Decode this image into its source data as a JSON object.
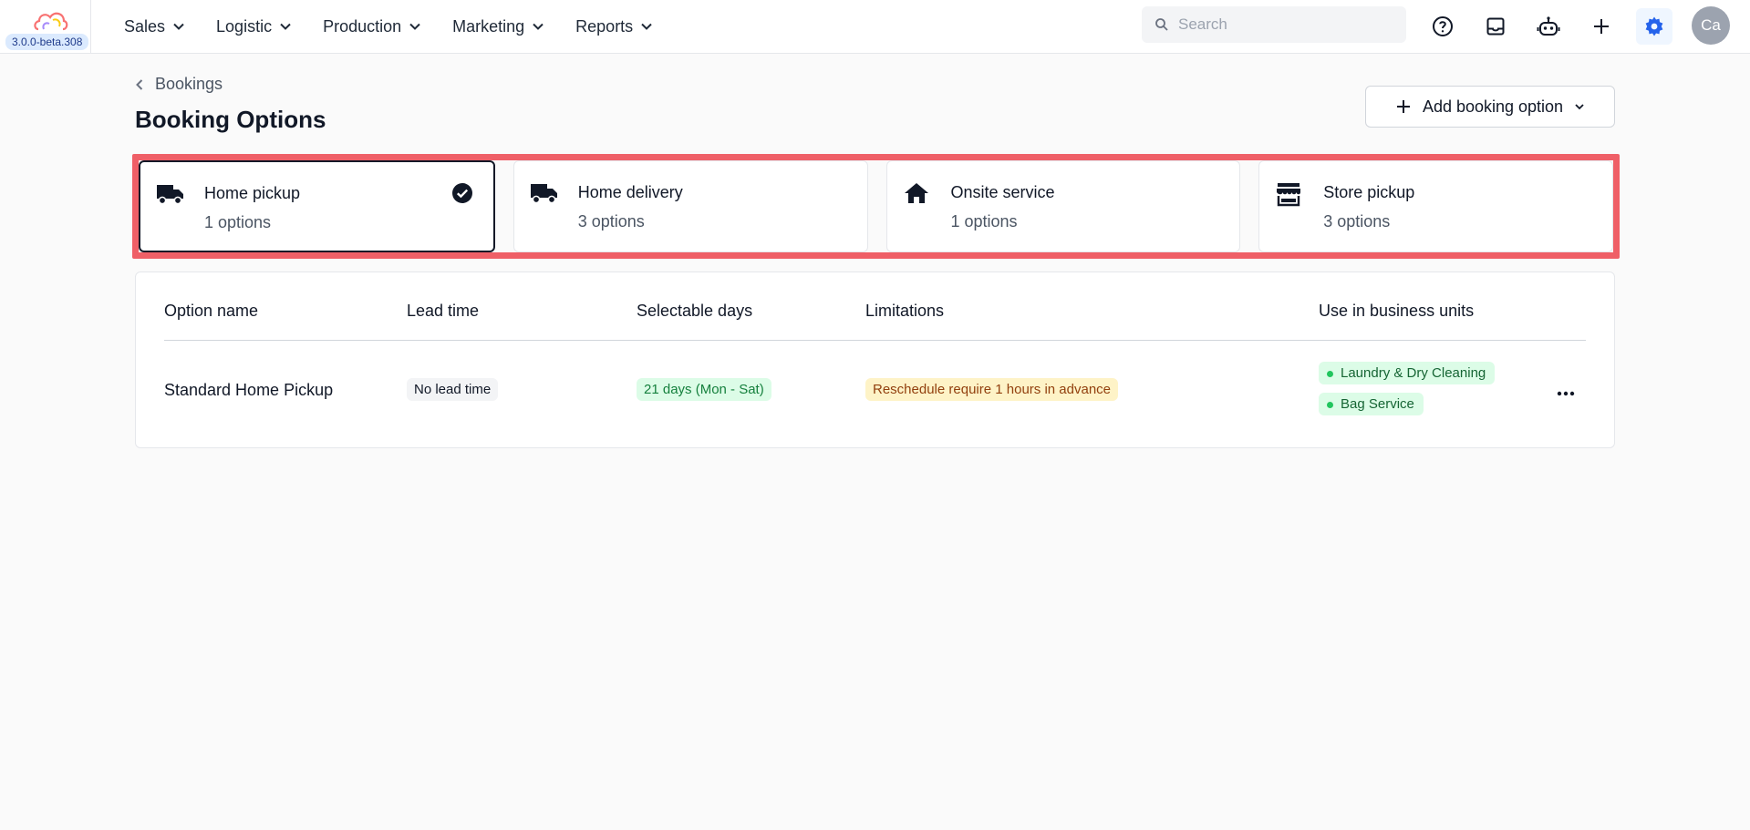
{
  "app": {
    "version": "3.0.0-beta.308"
  },
  "nav": {
    "items": [
      {
        "label": "Sales"
      },
      {
        "label": "Logistic"
      },
      {
        "label": "Production"
      },
      {
        "label": "Marketing"
      },
      {
        "label": "Reports"
      }
    ]
  },
  "search": {
    "placeholder": "Search",
    "value": ""
  },
  "toolbar_icons": [
    "help-icon",
    "inbox-icon",
    "bot-icon",
    "plus-icon",
    "settings-icon"
  ],
  "user": {
    "initials": "Ca"
  },
  "header": {
    "breadcrumb": "Bookings",
    "title": "Booking Options",
    "add_button_label": "Add booking option"
  },
  "booking_types": [
    {
      "name": "Home pickup",
      "count": "1 options",
      "icon": "truck-icon",
      "selected": true
    },
    {
      "name": "Home delivery",
      "count": "3 options",
      "icon": "truck-icon",
      "selected": false
    },
    {
      "name": "Onsite service",
      "count": "1 options",
      "icon": "house-icon",
      "selected": false
    },
    {
      "name": "Store pickup",
      "count": "3 options",
      "icon": "store-icon",
      "selected": false
    }
  ],
  "table": {
    "columns": [
      "Option name",
      "Lead time",
      "Selectable days",
      "Limitations",
      "Use in business units"
    ],
    "rows": [
      {
        "option_name": "Standard Home Pickup",
        "lead_time": "No lead time",
        "selectable_days": "21 days (Mon - Sat)",
        "limitations": "Reschedule require 1 hours in advance",
        "business_units": [
          "Laundry & Dry Cleaning",
          "Bag Service"
        ]
      }
    ]
  },
  "colors": {
    "highlight": "#ef5f67",
    "accent": "#2563eb",
    "green_badge": "#dcfce7",
    "yellow_badge": "#fef3c7"
  }
}
